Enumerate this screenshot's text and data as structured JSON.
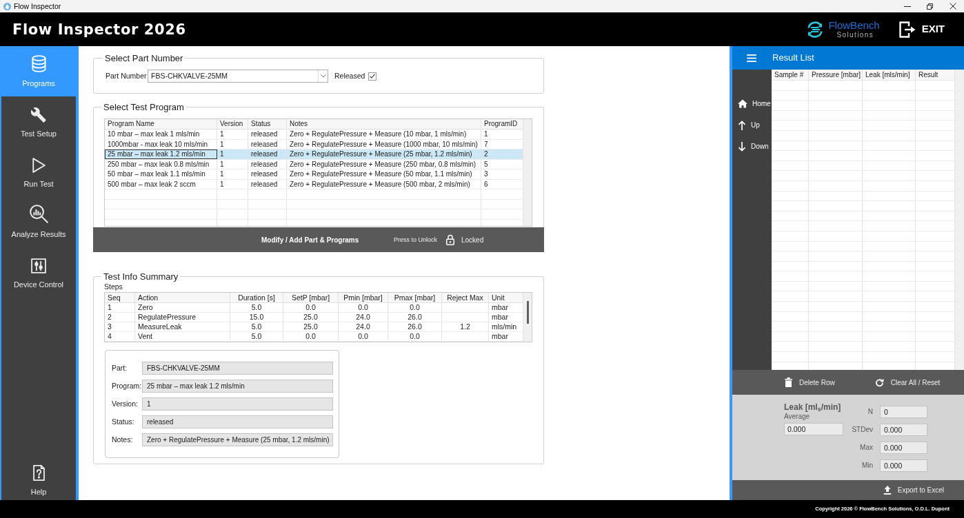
{
  "window": {
    "title": "Flow Inspector"
  },
  "header": {
    "app_title": "Flow Inspector 2026",
    "logo_name": "FlowBench",
    "logo_tagline": "Solutions",
    "exit_label": "EXIT"
  },
  "sidebar": {
    "items": [
      {
        "label": "Programs",
        "selected": true
      },
      {
        "label": "Test Setup",
        "selected": false
      },
      {
        "label": "Run Test",
        "selected": false
      },
      {
        "label": "Analyze Results",
        "selected": false
      },
      {
        "label": "Device Control",
        "selected": false
      }
    ],
    "footer_items": [
      {
        "label": "Help",
        "selected": false
      }
    ]
  },
  "part_number": {
    "legend": "Select Part Number",
    "label": "Part Number",
    "value": "FBS-CHKVALVE-25MM",
    "released_label": "Released",
    "released": true
  },
  "test_program": {
    "legend": "Select Test Program",
    "columns": [
      "Program Name",
      "Version",
      "Status",
      "Notes",
      "ProgramID"
    ],
    "rows": [
      {
        "cells": [
          "10 mbar – max leak 1 mls/min",
          "1",
          "released",
          "Zero + RegulatePressure + Measure (10 mbar, 1 mls/min)",
          "1"
        ],
        "selected": false
      },
      {
        "cells": [
          "1000mbar - max leak 10 mls/min",
          "1",
          "released",
          "Zero + RegulatePressure + Measure (1000 mbar, 10 mls/min)",
          "7"
        ],
        "selected": false
      },
      {
        "cells": [
          "25 mbar – max leak 1.2 mls/min",
          "1",
          "released",
          "Zero + RegulatePressure + Measure (25 mbar, 1.2 mls/min)",
          "2"
        ],
        "selected": true
      },
      {
        "cells": [
          "250 mbar – max leak 0.8 mls/min",
          "1",
          "released",
          "Zero + RegulatePressure + Measure (250 mbar, 0.8 mls/min)",
          "5"
        ],
        "selected": false
      },
      {
        "cells": [
          "50 mbar – max leak 1.1 mls/min",
          "1",
          "released",
          "Zero + RegulatePressure + Measure (50 mbar, 1.1 mls/min)",
          "3"
        ],
        "selected": false
      },
      {
        "cells": [
          "500 mbar – max leak 2 sccm",
          "1",
          "released",
          "Zero + RegulatePressure + Measure (500 mbar, 2 mls/min)",
          "6"
        ],
        "selected": false
      }
    ],
    "action_bar": {
      "button_label": "Modify / Add Part & Programs",
      "hint": "Press to Unlock",
      "lock_label": "Locked",
      "locked": true
    }
  },
  "test_info": {
    "legend": "Test Info Summary",
    "steps_label": "Steps",
    "steps_columns": [
      "Seq",
      "Action",
      "Duration [s]",
      "SetP [mbar]",
      "Pmin [mbar]",
      "Pmax [mbar]",
      "Reject Max",
      "Unit"
    ],
    "steps_rows": [
      [
        "1",
        "Zero",
        "5.0",
        "0.0",
        "0.0",
        "0.0",
        null,
        "mbar"
      ],
      [
        "2",
        "RegulatePressure",
        "15.0",
        "25.0",
        "24.0",
        "26.0",
        null,
        "mbar"
      ],
      [
        "3",
        "MeasureLeak",
        "5.0",
        "25.0",
        "24.0",
        "26.0",
        "1.2",
        "mls/min"
      ],
      [
        "4",
        "Vent",
        "5.0",
        "0.0",
        "0.0",
        "0.0",
        null,
        "mbar"
      ]
    ],
    "summary": [
      {
        "label": "Part:",
        "value": "FBS-CHKVALVE-25MM"
      },
      {
        "label": "Program:",
        "value": "25 mbar – max leak 1.2 mls/min"
      },
      {
        "label": "Version:",
        "value": "1"
      },
      {
        "label": "Status:",
        "value": "released"
      },
      {
        "label": "Notes:",
        "value": "Zero + RegulatePressure + Measure (25 mbar, 1.2 mls/min)"
      }
    ]
  },
  "result_list": {
    "title": "Result List",
    "nav": [
      {
        "label": "Home"
      },
      {
        "label": "Up"
      },
      {
        "label": "Down"
      }
    ],
    "columns": [
      "Sample #",
      "Pressure [mbar]",
      "Leak [mls/min]",
      "Result"
    ],
    "actions": [
      {
        "label": "Delete Row"
      },
      {
        "label": "Clear All / Reset"
      }
    ],
    "statistics": {
      "title": "Leak [ml$_{s}$/min]",
      "average_label": "Average",
      "average_value": "0.000",
      "items": [
        {
          "label": "N",
          "value": "0"
        },
        {
          "label": "STDev",
          "value": "0.000"
        },
        {
          "label": "Max",
          "value": "0.000"
        },
        {
          "label": "Min",
          "value": "0.000"
        }
      ]
    },
    "export_label": "Export to Excel"
  },
  "status_bar": {
    "copyright": "Copyright 2026 © FlowBench Solutions, O.D.L. Dupont"
  }
}
